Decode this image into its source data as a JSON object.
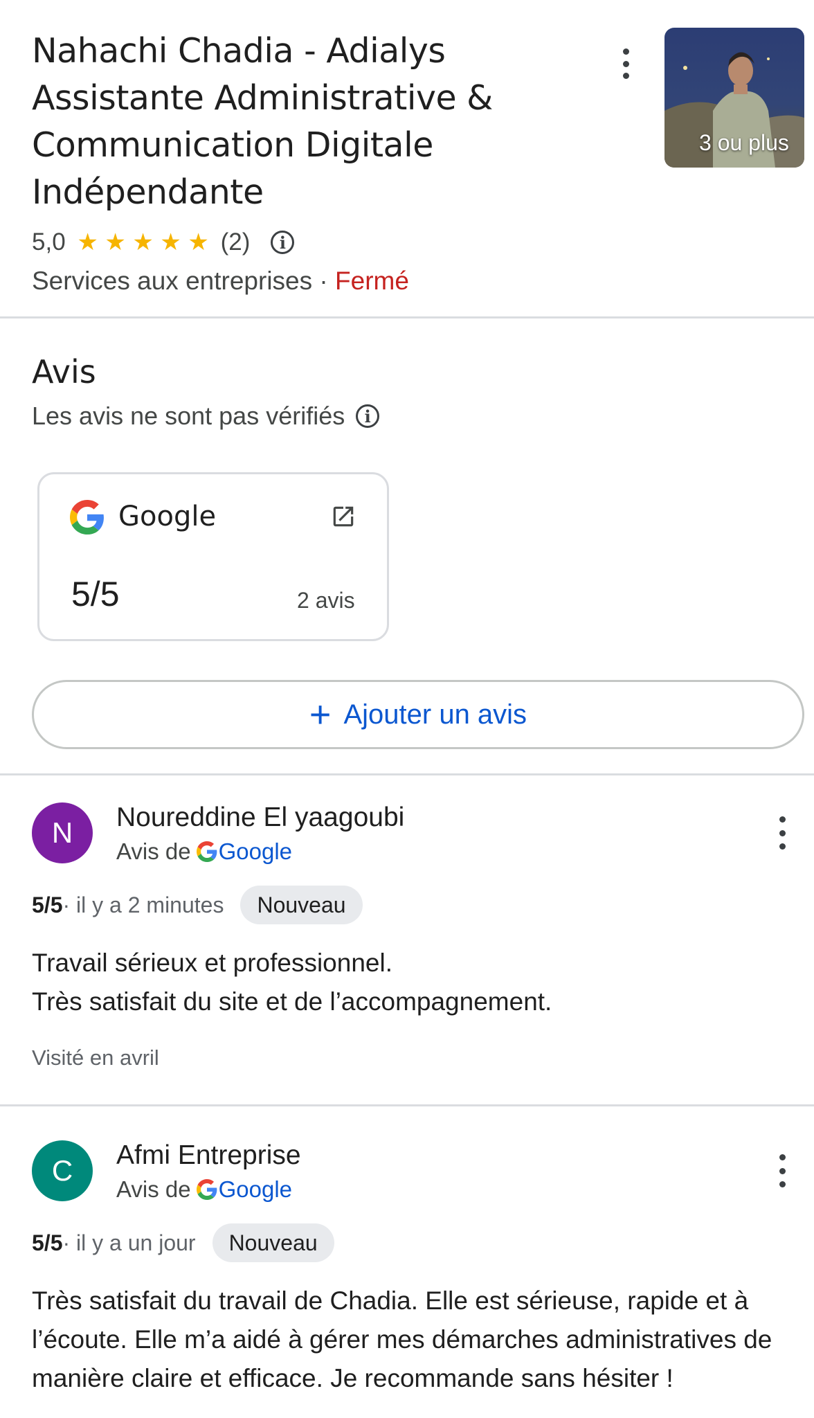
{
  "business": {
    "name": "Nahachi Chadia - Adialys Assistante Administrative & Communication Digitale Indépendante",
    "rating": "5,0",
    "stars": 5,
    "review_count": "(2)",
    "category": "Services aux entreprises",
    "separator": " · ",
    "status": "Fermé",
    "photo_label": "3 ou plus"
  },
  "reviews_section": {
    "heading": "Avis",
    "disclaimer": "Les avis ne sont pas vérifiés",
    "source_card": {
      "name": "Google",
      "score": "5/5",
      "count": "2 avis"
    },
    "add_review_label": "Ajouter un avis"
  },
  "reviews": [
    {
      "initial": "N",
      "avatar_color": "#7b1fa2",
      "author": "Noureddine El yaagoubi",
      "source_prefix": "Avis de",
      "source_name": "Google",
      "score": "5/5",
      "time": " · il y a 2 minutes",
      "badge": "Nouveau",
      "text": "Travail sérieux et professionnel.\nTrès satisfait du site et de l’accompagnement.",
      "visited": "Visité en avril"
    },
    {
      "initial": "C",
      "avatar_color": "#00897b",
      "author": "Afmi Entreprise",
      "source_prefix": "Avis de",
      "source_name": "Google",
      "score": "5/5",
      "time": " · il y a un jour",
      "badge": "Nouveau",
      "text": "Très satisfait du travail de Chadia. Elle est sérieuse, rapide et à l’écoute. Elle m’a aidé à gérer mes démarches administratives de manière claire et efficace. Je recommande sans hésiter !"
    }
  ],
  "icons": {
    "star": "★",
    "info": "i",
    "plus": "+"
  },
  "colors": {
    "accent_blue": "#0b57d0",
    "closed_red": "#c5221f",
    "star_yellow": "#f6b400"
  }
}
